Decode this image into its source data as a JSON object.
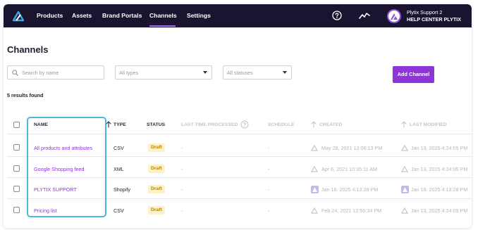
{
  "nav": {
    "items": [
      "Products",
      "Assets",
      "Brand Portals",
      "Channels",
      "Settings"
    ],
    "active": "Channels",
    "help_icon": "question-circle-icon",
    "activity_icon": "trend-line-icon"
  },
  "user": {
    "name": "Plytix Support 2",
    "org": "HELP CENTER PLYTIX"
  },
  "page": {
    "title": "Channels",
    "results": "5 results found"
  },
  "filters": {
    "search_placeholder": "Search by name",
    "types_value": "All types",
    "statuses_value": "All statuses"
  },
  "actions": {
    "add_channel": "Add Channel"
  },
  "table": {
    "headers": {
      "name": "NAME",
      "type": "TYPE",
      "status": "STATUS",
      "last_processed": "LAST TIME PROCESSED",
      "schedule": "SCHEDULE",
      "created": "CREATED",
      "last_modified": "LAST MODIFIED"
    },
    "rows": [
      {
        "name": "All products and attributes",
        "type": "CSV",
        "status": "Draft",
        "last_processed": "-",
        "schedule": "-",
        "created": "May 28, 2021 12:06:13 PM",
        "last_modified": "Jan 13, 2025 4:24:05 PM"
      },
      {
        "name": "Google Shopping feed",
        "type": "XML",
        "status": "Draft",
        "last_processed": "-",
        "schedule": "-",
        "created": "Apr 6, 2021 10:35:11 AM",
        "last_modified": "Jan 13, 2025 4:24:05 PM"
      },
      {
        "name": "PLYTIX SUPPORT",
        "type": "Shopify",
        "status": "Draft",
        "last_processed": "-",
        "schedule": "-",
        "created": "Jan 16, 2025 4:13:28 PM",
        "last_modified": "Jan 16, 2025 4:13:28 PM"
      },
      {
        "name": "Pricing list",
        "type": "CSV",
        "status": "Draft",
        "last_processed": "-",
        "schedule": "-",
        "created": "Feb 24, 2021 12:50:34 PM",
        "last_modified": "Jan 13, 2025 4:24:05 PM"
      }
    ]
  },
  "colors": {
    "topbar": "#1a1430",
    "accent": "#8e35d8",
    "highlight": "#4bb8dd",
    "draft_bg": "#fdf2c7",
    "draft_text": "#b8860b"
  }
}
